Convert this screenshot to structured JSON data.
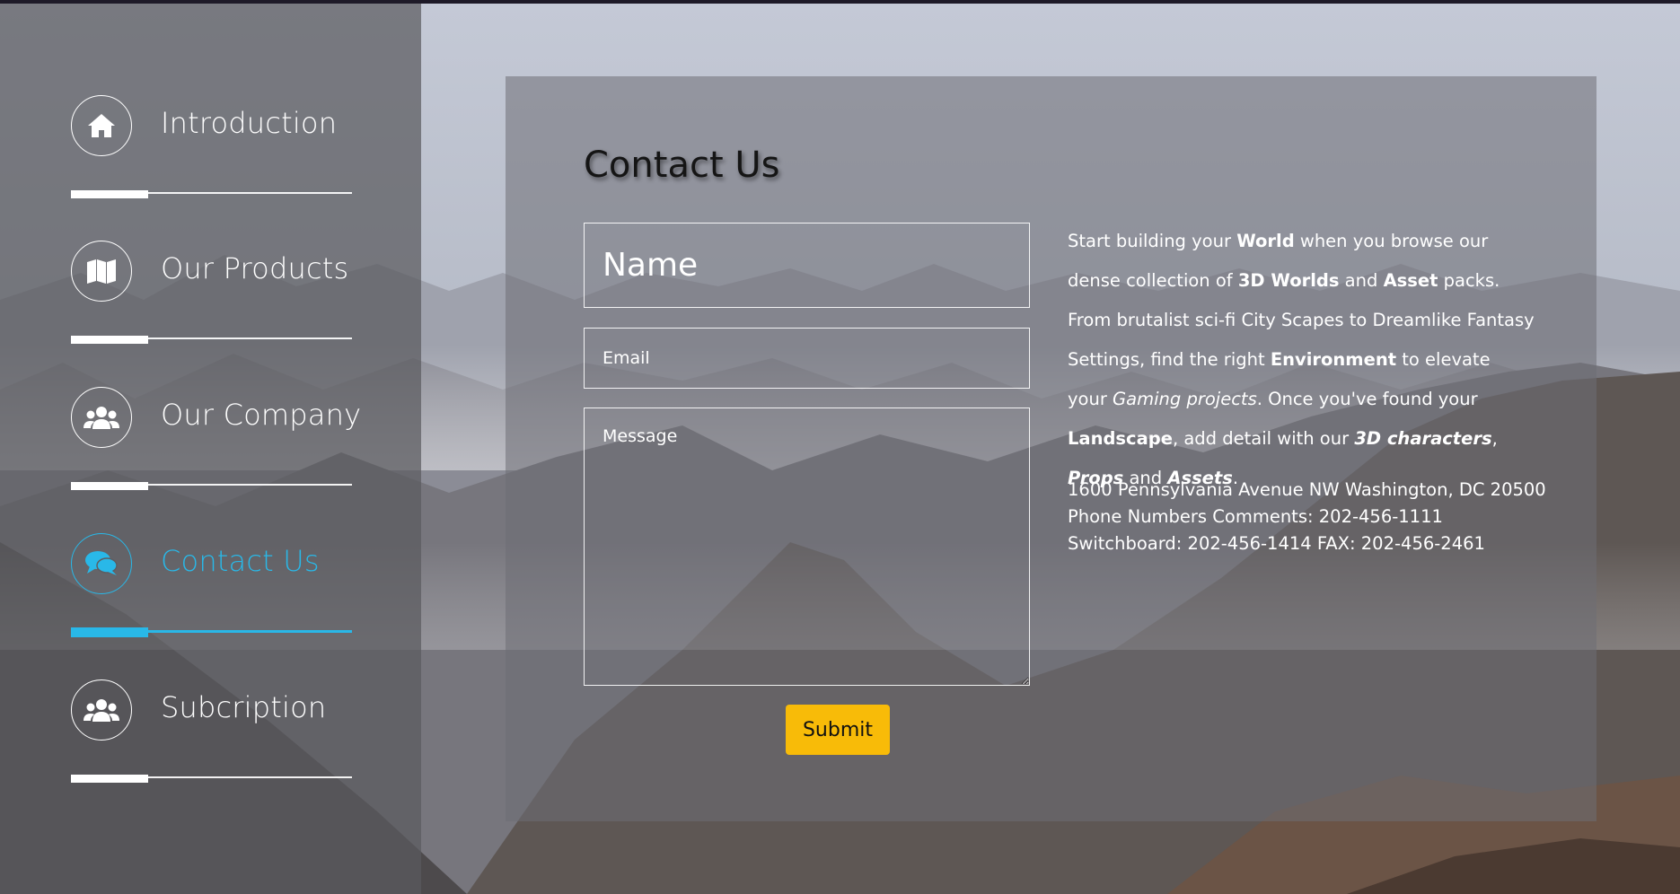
{
  "nav": {
    "items": [
      {
        "label": "Introduction",
        "icon": "home-icon",
        "active": false
      },
      {
        "label": "Our Products",
        "icon": "map-icon",
        "active": false
      },
      {
        "label": "Our Company",
        "icon": "users-icon",
        "active": false
      },
      {
        "label": "Contact Us",
        "icon": "comments-icon",
        "active": true
      },
      {
        "label": "Subcription",
        "icon": "users-icon",
        "active": false
      }
    ]
  },
  "contact": {
    "title": "Contact Us",
    "name_placeholder": "Name",
    "email_placeholder": "Email",
    "message_placeholder": "Message",
    "submit_label": "Submit",
    "info": {
      "p1": "Start building your ",
      "b1": "World",
      "p2": " when you browse our dense collection of ",
      "b2": "3D Worlds",
      "p3": " and ",
      "b3": "Asset",
      "p4": " packs. From brutalist sci-fi City Scapes to Dreamlike Fantasy Settings, find the right ",
      "b4": "Environment",
      "p5": " to elevate your ",
      "i1": "Gaming projects",
      "p6": ". Once you've found your ",
      "b5": "Landscape",
      "p7": ", add detail with our ",
      "bi1": "3D characters",
      "p8": ", ",
      "bi2": "Props",
      "p9": " and ",
      "bi3": "Assets",
      "p10": "."
    },
    "address": {
      "line1": "1600 Pennsylvania Avenue NW Washington, DC 20500",
      "line2": "Phone Numbers Comments: 202-456-1111",
      "line3": "Switchboard: 202-456-1414 FAX: 202-456-2461"
    }
  },
  "colors": {
    "accent": "#29b8e8",
    "submit": "#f8bb08"
  }
}
